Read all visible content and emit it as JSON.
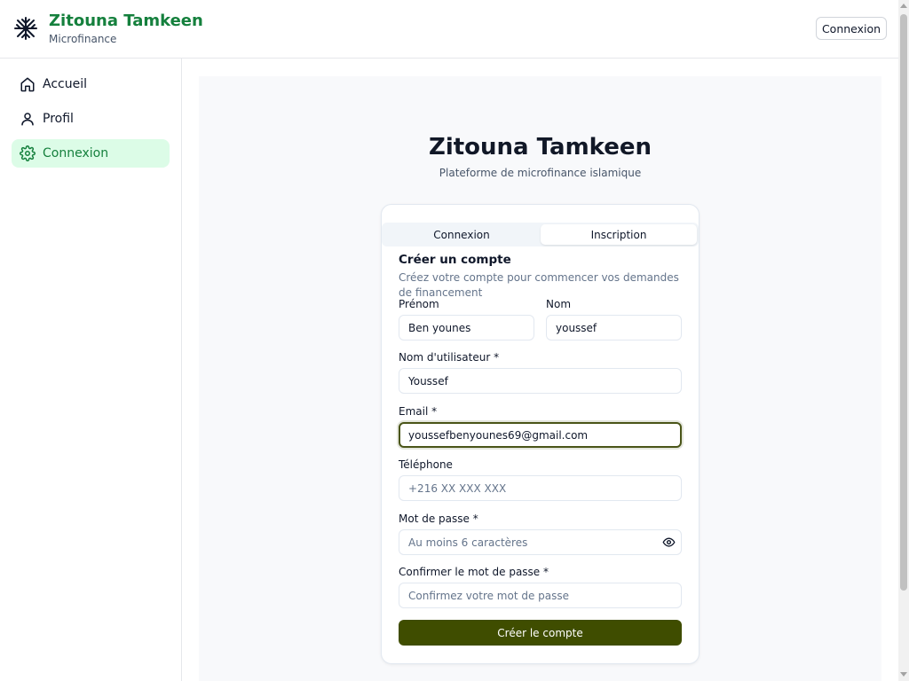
{
  "header": {
    "brand_title": "Zitouna Tamkeen",
    "brand_subtitle": "Microfinance",
    "login_button": "Connexion",
    "logo_icon": "tree-logo-icon"
  },
  "sidebar": {
    "items": [
      {
        "label": "Accueil",
        "icon": "home-icon",
        "active": false
      },
      {
        "label": "Profil",
        "icon": "user-icon",
        "active": false
      },
      {
        "label": "Connexion",
        "icon": "gear-icon",
        "active": true
      }
    ]
  },
  "main": {
    "title": "Zitouna Tamkeen",
    "subtitle": "Plateforme de microfinance islamique"
  },
  "auth_card": {
    "tabs": [
      {
        "label": "Connexion",
        "active": false
      },
      {
        "label": "Inscription",
        "active": true
      }
    ],
    "title": "Créer un compte",
    "description": "Créez votre compte pour commencer vos demandes de financement",
    "fields": {
      "prenom": {
        "label": "Prénom",
        "value": "Ben younes"
      },
      "nom": {
        "label": "Nom",
        "value": "youssef"
      },
      "username": {
        "label": "Nom d'utilisateur *",
        "value": "Youssef"
      },
      "email": {
        "label": "Email *",
        "value": "youssefbenyounes69@gmail.com"
      },
      "telephone": {
        "label": "Téléphone",
        "value": "",
        "placeholder": "+216 XX XXX XXX"
      },
      "password": {
        "label": "Mot de passe *",
        "value": "",
        "placeholder": "Au moins 6 caractères"
      },
      "confirm_password": {
        "label": "Confirmer le mot de passe *",
        "value": "",
        "placeholder": "Confirmez votre mot de passe"
      }
    },
    "submit_label": "Créer le compte"
  },
  "colors": {
    "brand_green": "#15803d",
    "active_nav_bg": "#dcfce7",
    "submit_bg": "#3f4d00",
    "focus_border": "#4a5518"
  }
}
